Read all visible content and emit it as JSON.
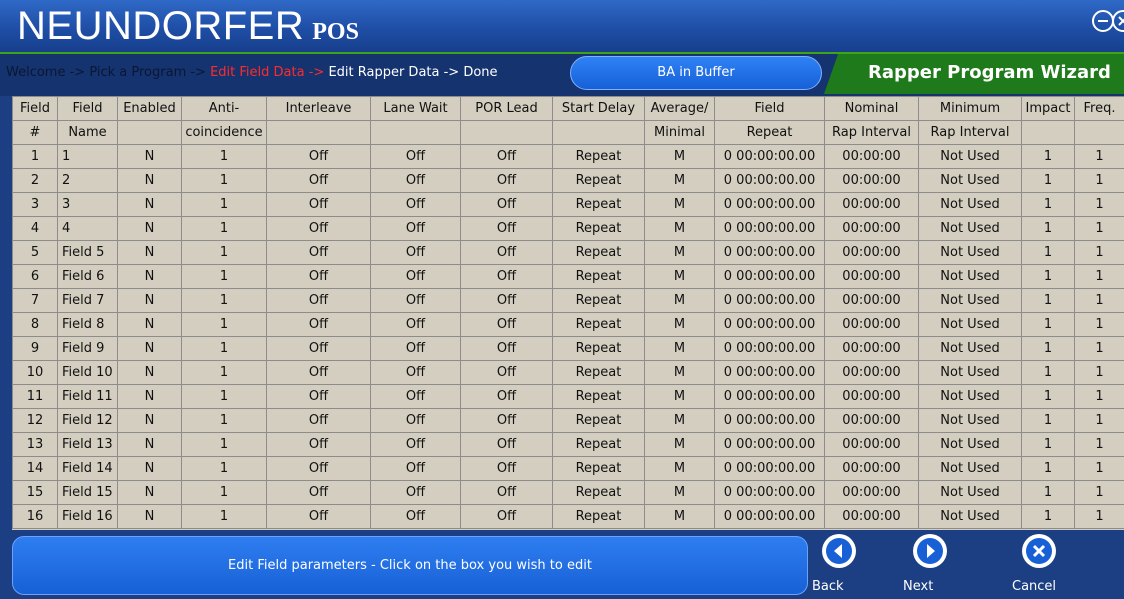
{
  "app": {
    "name": "NEUNDORFER",
    "sub": "POS",
    "minimize_glyph": "⊖",
    "close_glyph": "⊗"
  },
  "wizard": {
    "breadcrumb_done": "Welcome -> Pick a Program ->",
    "breadcrumb_current": "Edit Field Data ->",
    "breadcrumb_todo": "Edit Rapper Data -> Done",
    "buffer_status": "BA in Buffer",
    "title": "Rapper Program Wizard"
  },
  "table": {
    "headers": [
      [
        "Field",
        "#"
      ],
      [
        "Field",
        "Name"
      ],
      [
        "Enabled",
        ""
      ],
      [
        "Anti-",
        "coincidence"
      ],
      [
        "Interleave",
        ""
      ],
      [
        "Lane Wait",
        ""
      ],
      [
        "POR Lead",
        ""
      ],
      [
        "Start Delay",
        ""
      ],
      [
        "Average/",
        "Minimal"
      ],
      [
        "Field",
        "Repeat"
      ],
      [
        "Nominal",
        "Rap Interval"
      ],
      [
        "Minimum",
        "Rap Interval"
      ],
      [
        "Impact",
        ""
      ],
      [
        "Freq.",
        ""
      ]
    ],
    "rows": [
      [
        "1",
        "1",
        "N",
        "1",
        "Off",
        "Off",
        "Off",
        "Repeat",
        "M",
        "0 00:00:00.00",
        "00:00:00",
        "Not Used",
        "1",
        "1"
      ],
      [
        "2",
        "2",
        "N",
        "1",
        "Off",
        "Off",
        "Off",
        "Repeat",
        "M",
        "0 00:00:00.00",
        "00:00:00",
        "Not Used",
        "1",
        "1"
      ],
      [
        "3",
        "3",
        "N",
        "1",
        "Off",
        "Off",
        "Off",
        "Repeat",
        "M",
        "0 00:00:00.00",
        "00:00:00",
        "Not Used",
        "1",
        "1"
      ],
      [
        "4",
        "4",
        "N",
        "1",
        "Off",
        "Off",
        "Off",
        "Repeat",
        "M",
        "0 00:00:00.00",
        "00:00:00",
        "Not Used",
        "1",
        "1"
      ],
      [
        "5",
        "Field 5",
        "N",
        "1",
        "Off",
        "Off",
        "Off",
        "Repeat",
        "M",
        "0 00:00:00.00",
        "00:00:00",
        "Not Used",
        "1",
        "1"
      ],
      [
        "6",
        "Field 6",
        "N",
        "1",
        "Off",
        "Off",
        "Off",
        "Repeat",
        "M",
        "0 00:00:00.00",
        "00:00:00",
        "Not Used",
        "1",
        "1"
      ],
      [
        "7",
        "Field 7",
        "N",
        "1",
        "Off",
        "Off",
        "Off",
        "Repeat",
        "M",
        "0 00:00:00.00",
        "00:00:00",
        "Not Used",
        "1",
        "1"
      ],
      [
        "8",
        "Field 8",
        "N",
        "1",
        "Off",
        "Off",
        "Off",
        "Repeat",
        "M",
        "0 00:00:00.00",
        "00:00:00",
        "Not Used",
        "1",
        "1"
      ],
      [
        "9",
        "Field 9",
        "N",
        "1",
        "Off",
        "Off",
        "Off",
        "Repeat",
        "M",
        "0 00:00:00.00",
        "00:00:00",
        "Not Used",
        "1",
        "1"
      ],
      [
        "10",
        "Field 10",
        "N",
        "1",
        "Off",
        "Off",
        "Off",
        "Repeat",
        "M",
        "0 00:00:00.00",
        "00:00:00",
        "Not Used",
        "1",
        "1"
      ],
      [
        "11",
        "Field 11",
        "N",
        "1",
        "Off",
        "Off",
        "Off",
        "Repeat",
        "M",
        "0 00:00:00.00",
        "00:00:00",
        "Not Used",
        "1",
        "1"
      ],
      [
        "12",
        "Field 12",
        "N",
        "1",
        "Off",
        "Off",
        "Off",
        "Repeat",
        "M",
        "0 00:00:00.00",
        "00:00:00",
        "Not Used",
        "1",
        "1"
      ],
      [
        "13",
        "Field 13",
        "N",
        "1",
        "Off",
        "Off",
        "Off",
        "Repeat",
        "M",
        "0 00:00:00.00",
        "00:00:00",
        "Not Used",
        "1",
        "1"
      ],
      [
        "14",
        "Field 14",
        "N",
        "1",
        "Off",
        "Off",
        "Off",
        "Repeat",
        "M",
        "0 00:00:00.00",
        "00:00:00",
        "Not Used",
        "1",
        "1"
      ],
      [
        "15",
        "Field 15",
        "N",
        "1",
        "Off",
        "Off",
        "Off",
        "Repeat",
        "M",
        "0 00:00:00.00",
        "00:00:00",
        "Not Used",
        "1",
        "1"
      ],
      [
        "16",
        "Field 16",
        "N",
        "1",
        "Off",
        "Off",
        "Off",
        "Repeat",
        "M",
        "0 00:00:00.00",
        "00:00:00",
        "Not Used",
        "1",
        "1"
      ]
    ]
  },
  "footer": {
    "help_text": "Edit Field parameters - Click on the box you wish to edit",
    "back_label": "Back",
    "next_label": "Next",
    "cancel_label": "Cancel"
  },
  "icons": {
    "minimize": "minus-circle-icon",
    "close": "close-circle-icon",
    "back": "arrow-left-circle-icon",
    "next": "arrow-right-circle-icon",
    "cancel": "x-circle-icon"
  },
  "colors": {
    "breadcrumb_current": "#ff2b2b",
    "breadcrumb_done": "#0a1733",
    "wizard_title_bg": "#1e7a1a",
    "accent_blue": "#1760d6",
    "grid_bg": "#d4cec0"
  }
}
